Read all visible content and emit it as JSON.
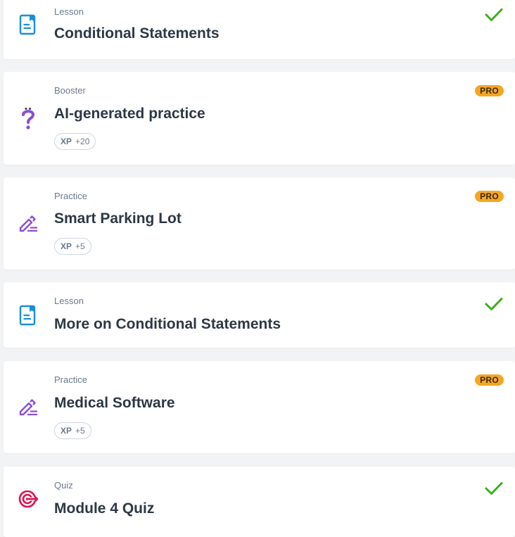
{
  "colors": {
    "background": "#f1f3f5",
    "card": "#ffffff",
    "lesson_icon": "#1a8fd8",
    "practice_icon": "#8a4dd6",
    "quiz_icon": "#e0104f",
    "check": "#3cae1e",
    "pro_badge": "#f5a623"
  },
  "items": [
    {
      "kind": "Lesson",
      "title": "Conditional Statements",
      "icon": "lesson-doc-icon",
      "status": "completed"
    },
    {
      "kind": "Booster",
      "title": "AI-generated practice",
      "icon": "question-mark-icon",
      "pro_label": "PRO",
      "xp_label": "XP",
      "xp_value": "+20"
    },
    {
      "kind": "Practice",
      "title": "Smart Parking Lot",
      "icon": "pencil-icon",
      "pro_label": "PRO",
      "xp_label": "XP",
      "xp_value": "+5"
    },
    {
      "kind": "Lesson",
      "title": "More on Conditional Statements",
      "icon": "lesson-doc-icon",
      "status": "completed"
    },
    {
      "kind": "Practice",
      "title": "Medical Software",
      "icon": "pencil-icon",
      "pro_label": "PRO",
      "xp_label": "XP",
      "xp_value": "+5"
    },
    {
      "kind": "Quiz",
      "title": "Module 4 Quiz",
      "icon": "target-icon",
      "status": "completed"
    }
  ]
}
